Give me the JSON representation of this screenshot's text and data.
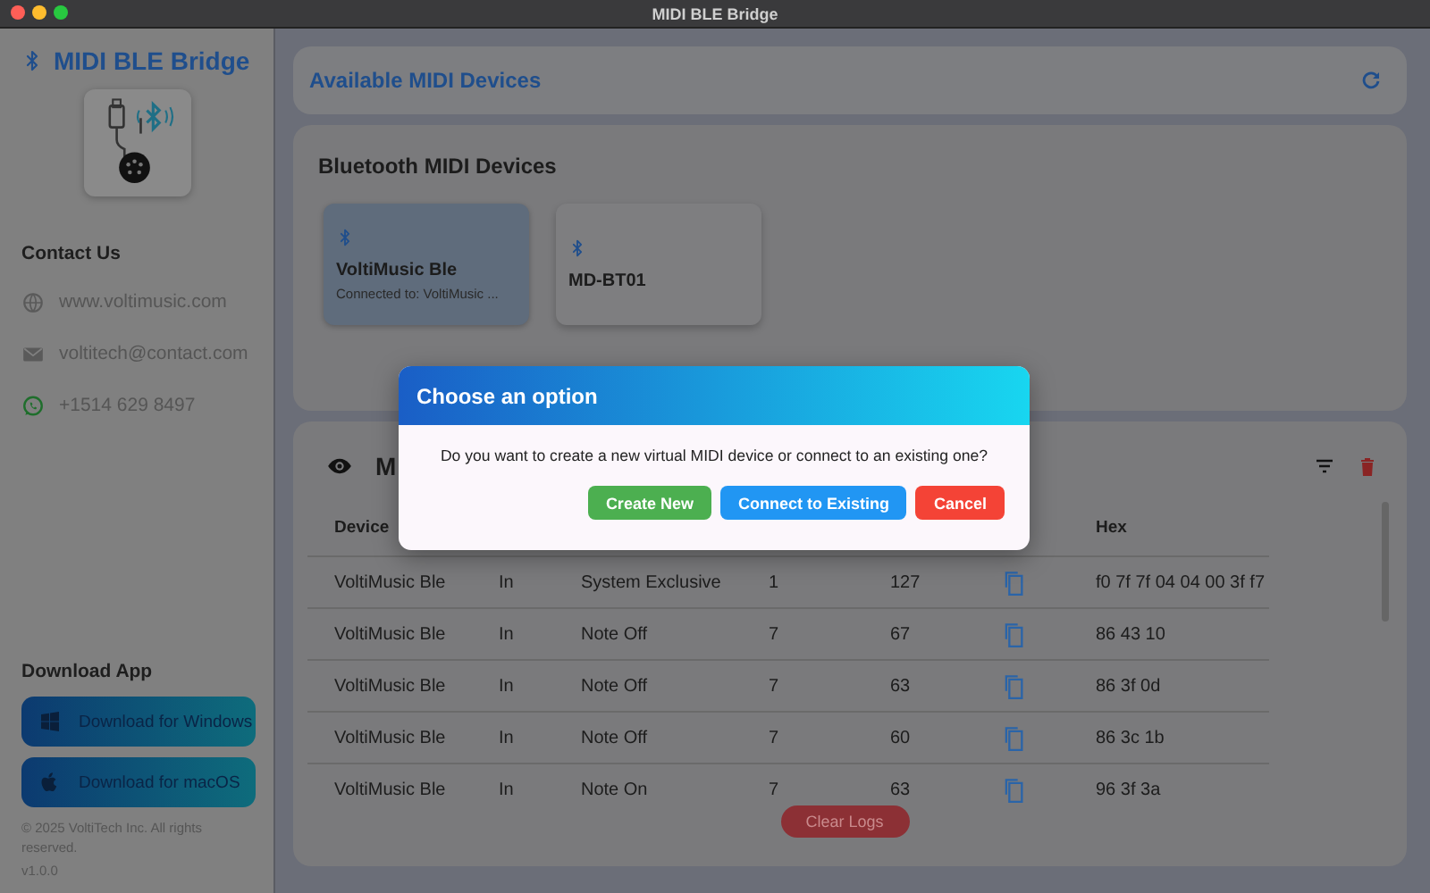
{
  "window": {
    "title": "MIDI BLE Bridge"
  },
  "sidebar": {
    "app_title": "MIDI BLE Bridge",
    "contact_heading": "Contact Us",
    "contacts": [
      {
        "kind": "web",
        "text": "www.voltimusic.com"
      },
      {
        "kind": "email",
        "text": "voltitech@contact.com"
      },
      {
        "kind": "whatsapp",
        "text": "+1514 629 8497"
      }
    ],
    "download_heading": "Download App",
    "downloads": [
      {
        "kind": "windows",
        "label": "Download for Windows"
      },
      {
        "kind": "apple",
        "label": "Download for macOS"
      }
    ],
    "copyright": "© 2025 VoltiTech Inc. All rights reserved.",
    "version": "v1.0.0"
  },
  "available_devices": {
    "title": "Available MIDI Devices"
  },
  "bluetooth": {
    "title": "Bluetooth MIDI Devices",
    "devices": [
      {
        "name": "VoltiMusic Ble",
        "status": "Connected to: VoltiMusic ...",
        "selected": true
      },
      {
        "name": "MD-BT01",
        "selected": false
      }
    ]
  },
  "logs": {
    "title": "M",
    "header": {
      "device": "Device",
      "hex": "Hex"
    },
    "rows": [
      {
        "device": "VoltiMusic Ble",
        "direction": "In",
        "type": "System Exclusive",
        "channel": "1",
        "value": "127",
        "hex": "f0 7f 7f 04 04 00 3f f7"
      },
      {
        "device": "VoltiMusic Ble",
        "direction": "In",
        "type": "Note Off",
        "channel": "7",
        "value": "67",
        "hex": "86 43 10"
      },
      {
        "device": "VoltiMusic Ble",
        "direction": "In",
        "type": "Note Off",
        "channel": "7",
        "value": "63",
        "hex": "86 3f 0d"
      },
      {
        "device": "VoltiMusic Ble",
        "direction": "In",
        "type": "Note Off",
        "channel": "7",
        "value": "60",
        "hex": "86 3c 1b"
      },
      {
        "device": "VoltiMusic Ble",
        "direction": "In",
        "type": "Note On",
        "channel": "7",
        "value": "63",
        "hex": "96 3f 3a"
      }
    ],
    "clear_button": "Clear Logs"
  },
  "dialog": {
    "title": "Choose an option",
    "message": "Do you want to create a new virtual MIDI device or connect to an existing one?",
    "buttons": [
      {
        "kind": "success",
        "label": "Create New"
      },
      {
        "kind": "primary",
        "label": "Connect to Existing"
      },
      {
        "kind": "danger",
        "label": "Cancel"
      }
    ]
  }
}
